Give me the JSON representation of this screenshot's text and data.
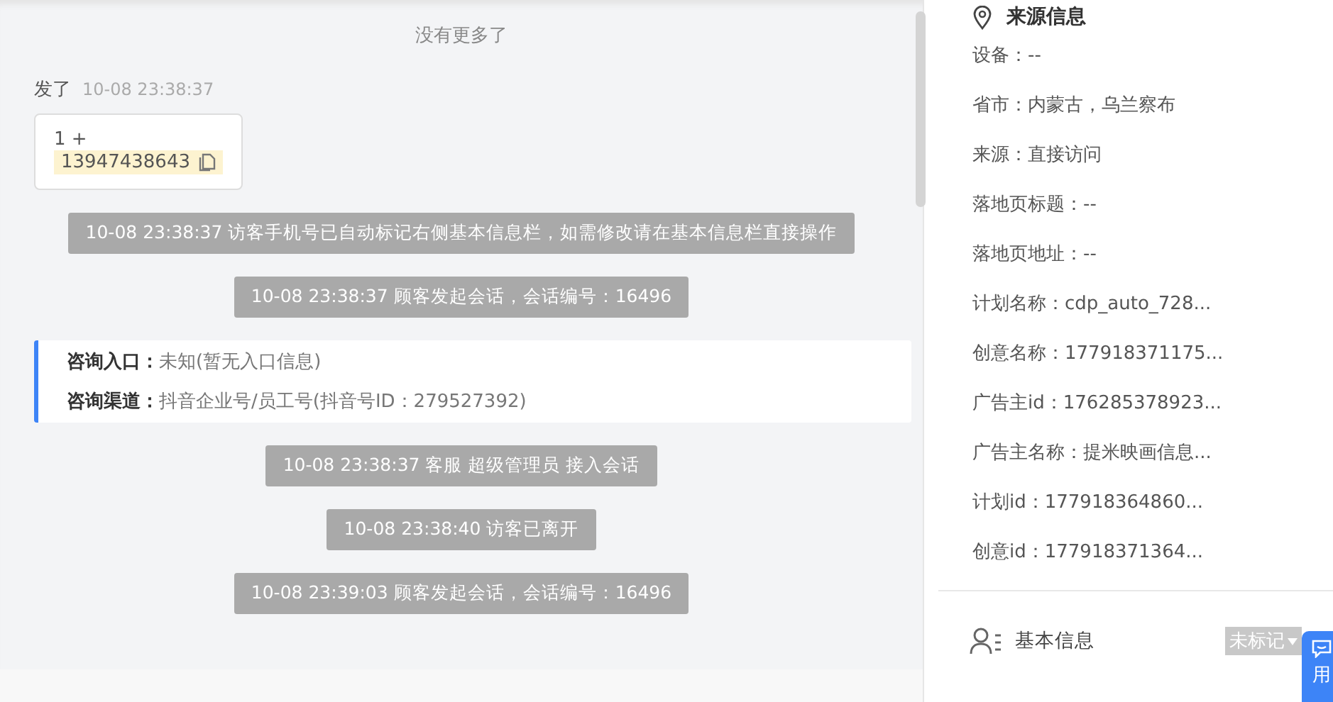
{
  "chat": {
    "no_more": "没有更多了",
    "message": {
      "sender": "发了",
      "time": "10-08 23:38:37",
      "line": "1 +",
      "phone": "13947438643"
    },
    "events": [
      {
        "kind": "system",
        "text": "10-08 23:38:37 访客手机号已自动标记右侧基本信息栏，如需修改请在基本信息栏直接操作"
      },
      {
        "kind": "system",
        "text": "10-08 23:38:37 顾客发起会话，会话编号：16496"
      },
      {
        "kind": "info",
        "rows": [
          {
            "label": "咨询入口：",
            "value": "未知(暂无入口信息)"
          },
          {
            "label": "咨询渠道：",
            "value": "抖音企业号/员工号(抖音号ID：279527392)"
          }
        ]
      },
      {
        "kind": "system",
        "text": "10-08 23:38:37 客服 超级管理员 接入会话"
      },
      {
        "kind": "system",
        "text": "10-08 23:38:40 访客已离开"
      },
      {
        "kind": "system",
        "text": "10-08 23:39:03 顾客发起会话，会话编号：16496"
      }
    ]
  },
  "source_info": {
    "title": "来源信息",
    "items": [
      "设备：--",
      "省市：内蒙古，乌兰察布",
      "来源：直接访问",
      "落地页标题：--",
      "落地页地址：--",
      "计划名称：cdp_auto_728...",
      "创意名称：177918371175...",
      "广告主id：176285378923...",
      "广告主名称：提米映画信息...",
      "计划id：177918364860...",
      "创意id：177918371364..."
    ]
  },
  "basic_info": {
    "title": "基本信息",
    "tag": "未标记"
  },
  "float_button": {
    "label": "用"
  }
}
